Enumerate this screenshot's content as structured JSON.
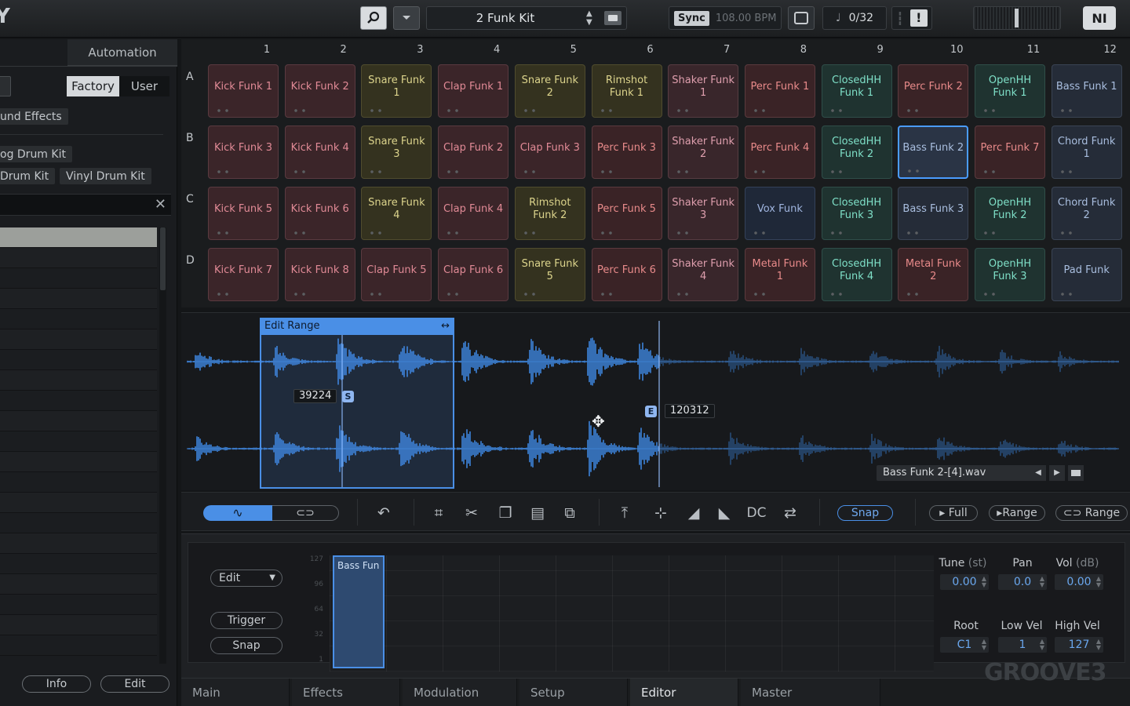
{
  "topbar": {
    "kit_name": "2 Funk Kit",
    "sync_label": "Sync",
    "bpm": "108.00 BPM",
    "counter": "0/32",
    "warn_glyph": "!",
    "ni_logo": "NI"
  },
  "left_panel": {
    "tab_label": "Automation",
    "factory_label": "Factory",
    "user_label": "User",
    "tags": [
      "und Effects",
      "og Drum Kit",
      "Drum Kit",
      "Vinyl Drum Kit"
    ],
    "info_label": "Info",
    "edit_label": "Edit"
  },
  "pads": {
    "columns": [
      "1",
      "2",
      "3",
      "4",
      "5",
      "6",
      "7",
      "8",
      "9",
      "10",
      "11",
      "12"
    ],
    "rows": [
      "A",
      "B",
      "C",
      "D"
    ],
    "cells": [
      [
        {
          "t": "Kick Funk 1",
          "c": "kick"
        },
        {
          "t": "Kick Funk 2",
          "c": "kick"
        },
        {
          "t": "Snare Funk 1",
          "c": "snare"
        },
        {
          "t": "Clap Funk 1",
          "c": "kick"
        },
        {
          "t": "Snare Funk 2",
          "c": "snare"
        },
        {
          "t": "Rimshot Funk 1",
          "c": "snare"
        },
        {
          "t": "Shaker Funk 1",
          "c": "shaker"
        },
        {
          "t": "Perc Funk 1",
          "c": "perc"
        },
        {
          "t": "ClosedHH Funk 1",
          "c": "hh"
        },
        {
          "t": "Perc Funk 2",
          "c": "perc"
        },
        {
          "t": "OpenHH Funk 1",
          "c": "hh"
        },
        {
          "t": "Bass Funk 1",
          "c": "bass"
        }
      ],
      [
        {
          "t": "Kick Funk 3",
          "c": "kick"
        },
        {
          "t": "Kick Funk 4",
          "c": "kick"
        },
        {
          "t": "Snare Funk 3",
          "c": "snare"
        },
        {
          "t": "Clap Funk 2",
          "c": "kick"
        },
        {
          "t": "Clap Funk 3",
          "c": "kick"
        },
        {
          "t": "Perc Funk 3",
          "c": "perc"
        },
        {
          "t": "Shaker Funk 2",
          "c": "shaker"
        },
        {
          "t": "Perc Funk 4",
          "c": "perc"
        },
        {
          "t": "ClosedHH Funk 2",
          "c": "hh"
        },
        {
          "t": "Bass Funk 2",
          "c": "bass sel"
        },
        {
          "t": "Perc Funk 7",
          "c": "perc"
        },
        {
          "t": "Chord Funk 1",
          "c": "bass"
        }
      ],
      [
        {
          "t": "Kick Funk 5",
          "c": "kick"
        },
        {
          "t": "Kick Funk 6",
          "c": "kick"
        },
        {
          "t": "Snare Funk 4",
          "c": "snare"
        },
        {
          "t": "Clap Funk 4",
          "c": "kick"
        },
        {
          "t": "Rimshot Funk 2",
          "c": "snare"
        },
        {
          "t": "Perc Funk 5",
          "c": "perc"
        },
        {
          "t": "Shaker Funk 3",
          "c": "shaker"
        },
        {
          "t": "Vox Funk",
          "c": "vox"
        },
        {
          "t": "ClosedHH Funk 3",
          "c": "hh"
        },
        {
          "t": "Bass Funk 3",
          "c": "bass"
        },
        {
          "t": "OpenHH Funk 2",
          "c": "hh"
        },
        {
          "t": "Chord Funk 2",
          "c": "bass"
        }
      ],
      [
        {
          "t": "Kick Funk 7",
          "c": "kick"
        },
        {
          "t": "Kick Funk 8",
          "c": "kick"
        },
        {
          "t": "Clap Funk 5",
          "c": "kick"
        },
        {
          "t": "Clap Funk 6",
          "c": "kick"
        },
        {
          "t": "Snare Funk 5",
          "c": "snare"
        },
        {
          "t": "Perc Funk 6",
          "c": "perc"
        },
        {
          "t": "Shaker Funk 4",
          "c": "shaker"
        },
        {
          "t": "Metal Funk 1",
          "c": "perc"
        },
        {
          "t": "ClosedHH Funk 4",
          "c": "hh"
        },
        {
          "t": "Metal Funk 2",
          "c": "perc"
        },
        {
          "t": "OpenHH Funk 3",
          "c": "hh"
        },
        {
          "t": "Pad Funk",
          "c": "bass"
        }
      ]
    ]
  },
  "waveform": {
    "edit_range_label": "Edit Range",
    "start_value": "39224",
    "start_tag": "S",
    "end_value": "120312",
    "end_tag": "E",
    "file_name": "Bass Funk 2-[4].wav",
    "color": "#3f8ae6"
  },
  "toolbar": {
    "dc_label": "DC",
    "snap_label": "Snap",
    "full_label": "Full",
    "range_label": "Range",
    "loop_range_label": "Range"
  },
  "zone_editor": {
    "edit_label": "Edit",
    "trigger_label": "Trigger",
    "snap_label": "Snap",
    "velocity_ticks": [
      "127",
      "96",
      "64",
      "32",
      "1"
    ],
    "zone_name": "Bass Fun",
    "params": {
      "tune_label": "Tune",
      "tune_unit": "(st)",
      "tune_value": "0.00",
      "pan_label": "Pan",
      "pan_value": "0.0",
      "vol_label": "Vol",
      "vol_unit": "(dB)",
      "vol_value": "0.00",
      "root_label": "Root",
      "root_value": "C1",
      "lowvel_label": "Low Vel",
      "lowvel_value": "1",
      "highvel_label": "High Vel",
      "highvel_value": "127"
    }
  },
  "bottom_tabs": [
    "Main",
    "Effects",
    "Modulation",
    "Setup",
    "Editor",
    "Master"
  ],
  "brand": "GROOVE3"
}
